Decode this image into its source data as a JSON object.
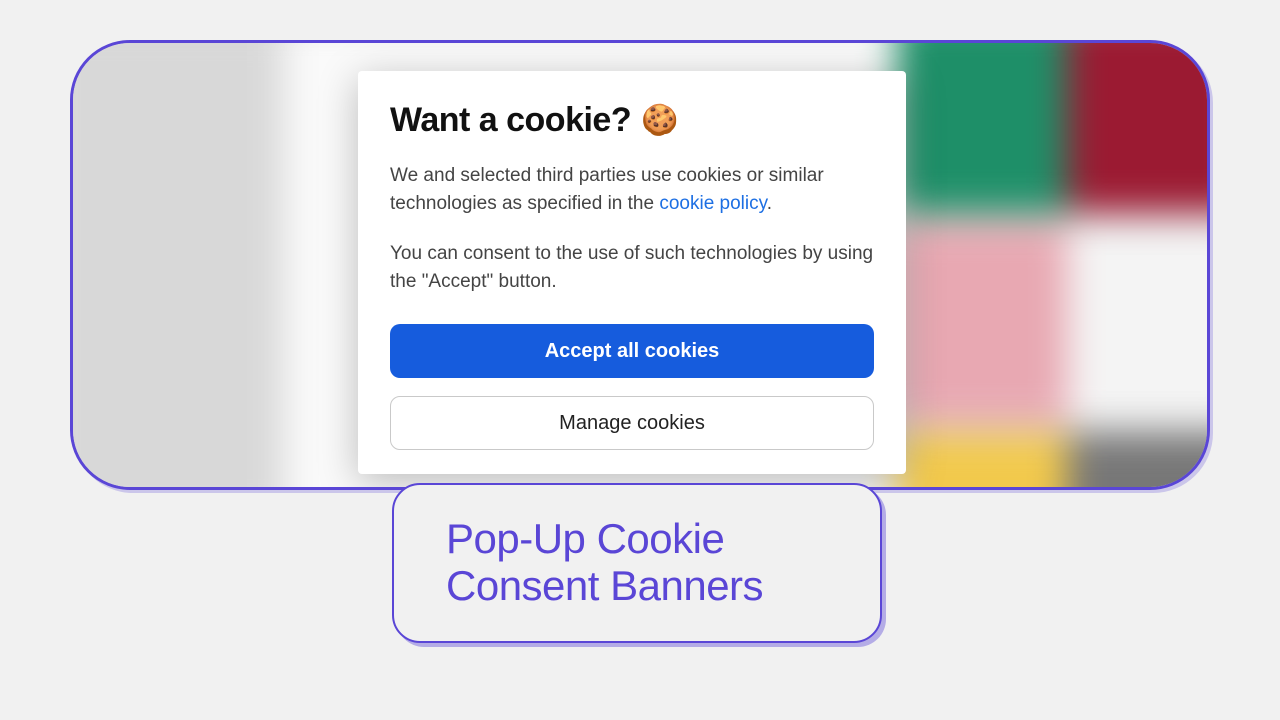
{
  "dialog": {
    "title": "Want a cookie?",
    "emoji": "🍪",
    "paragraph1_pre": "We and selected third parties use cookies or similar technologies as specified in the ",
    "policy_link_text": "cookie policy",
    "paragraph1_post": ".",
    "paragraph2": "You can consent to the use of such technologies by using the \"Accept\" button.",
    "accept_label": "Accept all cookies",
    "manage_label": "Manage cookies"
  },
  "caption": {
    "text": "Pop-Up Cookie Consent Banners"
  },
  "colors": {
    "accent": "#5a46d6",
    "primary_button": "#165cdd",
    "link": "#1d6fe3"
  }
}
